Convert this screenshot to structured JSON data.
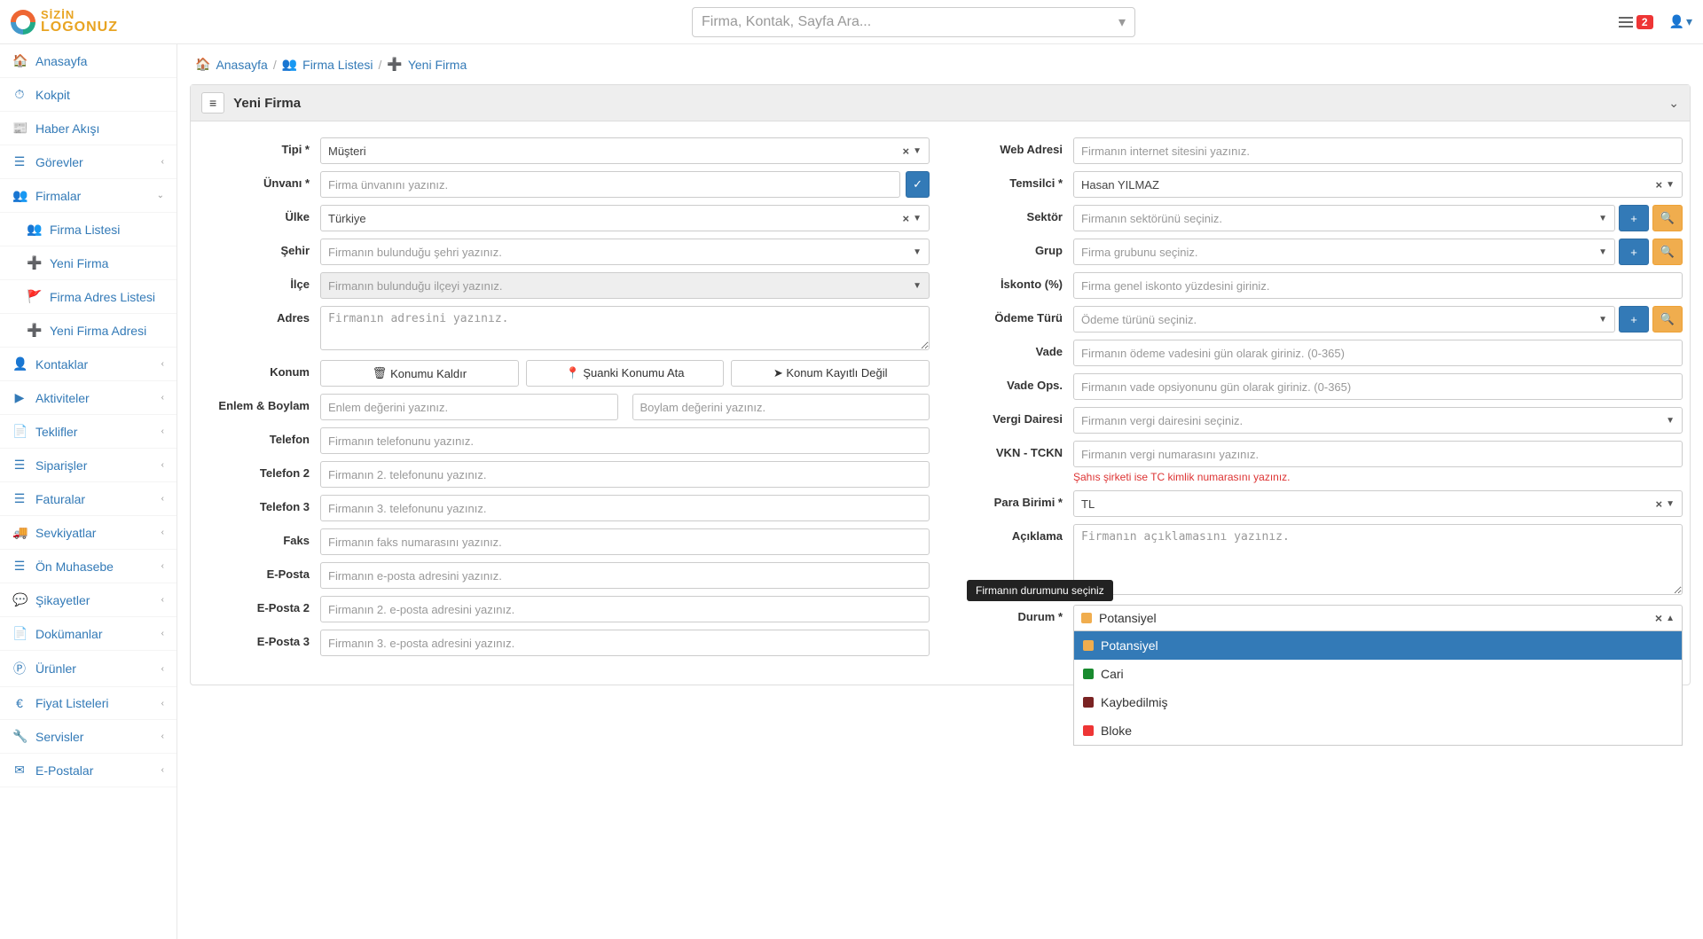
{
  "logo": {
    "line1": "SİZİN",
    "line2": "LOGONUZ"
  },
  "search_placeholder": "Firma, Kontak, Sayfa Ara...",
  "notif_count": "2",
  "sidebar": [
    {
      "label": "Anasayfa",
      "icon": "home"
    },
    {
      "label": "Kokpit",
      "icon": "gauge"
    },
    {
      "label": "Haber Akışı",
      "icon": "news"
    },
    {
      "label": "Görevler",
      "icon": "list",
      "chev": "‹"
    },
    {
      "label": "Firmalar",
      "icon": "users",
      "chev": "⌄",
      "children": [
        {
          "label": "Firma Listesi",
          "icon": "users"
        },
        {
          "label": "Yeni Firma",
          "icon": "plus"
        }
      ]
    },
    {
      "label": "Firma Adres Listesi",
      "icon": "flag",
      "sub": true
    },
    {
      "label": "Yeni Firma Adresi",
      "icon": "plus",
      "sub": true
    },
    {
      "label": "Kontaklar",
      "icon": "user",
      "chev": "‹"
    },
    {
      "label": "Aktiviteler",
      "icon": "play",
      "chev": "‹"
    },
    {
      "label": "Teklifler",
      "icon": "file",
      "chev": "‹"
    },
    {
      "label": "Siparişler",
      "icon": "list",
      "chev": "‹"
    },
    {
      "label": "Faturalar",
      "icon": "list",
      "chev": "‹"
    },
    {
      "label": "Sevkiyatlar",
      "icon": "truck",
      "chev": "‹"
    },
    {
      "label": "Ön Muhasebe",
      "icon": "list",
      "chev": "‹"
    },
    {
      "label": "Şikayetler",
      "icon": "chat",
      "chev": "‹"
    },
    {
      "label": "Dokümanlar",
      "icon": "file",
      "chev": "‹"
    },
    {
      "label": "Ürünler",
      "icon": "p",
      "chev": "‹"
    },
    {
      "label": "Fiyat Listeleri",
      "icon": "euro",
      "chev": "‹"
    },
    {
      "label": "Servisler",
      "icon": "wrench",
      "chev": "‹"
    },
    {
      "label": "E-Postalar",
      "icon": "mail",
      "chev": "‹"
    }
  ],
  "breadcrumb": {
    "home": "Anasayfa",
    "list": "Firma Listesi",
    "new": "Yeni Firma"
  },
  "panel": {
    "title": "Yeni Firma"
  },
  "labels": {
    "tipi": "Tipi *",
    "unvani": "Ünvanı *",
    "ulke": "Ülke",
    "sehir": "Şehir",
    "ilce": "İlçe",
    "adres": "Adres",
    "konum": "Konum",
    "enlem": "Enlem & Boylam",
    "telefon": "Telefon",
    "telefon2": "Telefon 2",
    "telefon3": "Telefon 3",
    "faks": "Faks",
    "eposta": "E-Posta",
    "eposta2": "E-Posta 2",
    "eposta3": "E-Posta 3",
    "web": "Web Adresi",
    "temsilci": "Temsilci *",
    "sektor": "Sektör",
    "grup": "Grup",
    "iskonto": "İskonto (%)",
    "odeme": "Ödeme Türü",
    "vade": "Vade",
    "vadeops": "Vade Ops.",
    "vergidaire": "Vergi Dairesi",
    "vkn": "VKN - TCKN",
    "para": "Para Birimi *",
    "aciklama": "Açıklama",
    "durum": "Durum *"
  },
  "values": {
    "tipi": "Müşteri",
    "ulke": "Türkiye",
    "temsilci": "Hasan YILMAZ",
    "para": "TL"
  },
  "placeholders": {
    "unvani": "Firma ünvanını yazınız.",
    "sehir": "Firmanın bulunduğu şehri yazınız.",
    "ilce": "Firmanın bulunduğu ilçeyi yazınız.",
    "adres": "Firmanın adresini yazınız.",
    "enlem": "Enlem değerini yazınız.",
    "boylam": "Boylam değerini yazınız.",
    "telefon": "Firmanın telefonunu yazınız.",
    "telefon2": "Firmanın 2. telefonunu yazınız.",
    "telefon3": "Firmanın 3. telefonunu yazınız.",
    "faks": "Firmanın faks numarasını yazınız.",
    "eposta": "Firmanın e-posta adresini yazınız.",
    "eposta2": "Firmanın 2. e-posta adresini yazınız.",
    "eposta3": "Firmanın 3. e-posta adresini yazınız.",
    "web": "Firmanın internet sitesini yazınız.",
    "sektor": "Firmanın sektörünü seçiniz.",
    "grup": "Firma grubunu seçiniz.",
    "iskonto": "Firma genel iskonto yüzdesini giriniz.",
    "odeme": "Ödeme türünü seçiniz.",
    "vade": "Firmanın ödeme vadesini gün olarak giriniz. (0-365)",
    "vadeops": "Firmanın vade opsiyonunu gün olarak giriniz. (0-365)",
    "vergidaire": "Firmanın vergi dairesini seçiniz.",
    "vkn": "Firmanın vergi numarasını yazınız.",
    "aciklama": "Firmanın açıklamasını yazınız."
  },
  "buttons": {
    "konumu_kaldir": "Konumu Kaldır",
    "suanki_konumu": "Şuanki Konumu Ata",
    "konum_kayitli": "Konum Kayıtlı Değil"
  },
  "vkn_help": "Şahıs şirketi ise TC kimlik numarasını yazınız.",
  "durum": {
    "tooltip": "Firmanın durumunu seçiniz",
    "selected": "Potansiyel",
    "options": [
      {
        "label": "Potansiyel",
        "color": "sw-orange"
      },
      {
        "label": "Cari",
        "color": "sw-green"
      },
      {
        "label": "Kaybedilmiş",
        "color": "sw-brown"
      },
      {
        "label": "Bloke",
        "color": "sw-red"
      }
    ]
  }
}
